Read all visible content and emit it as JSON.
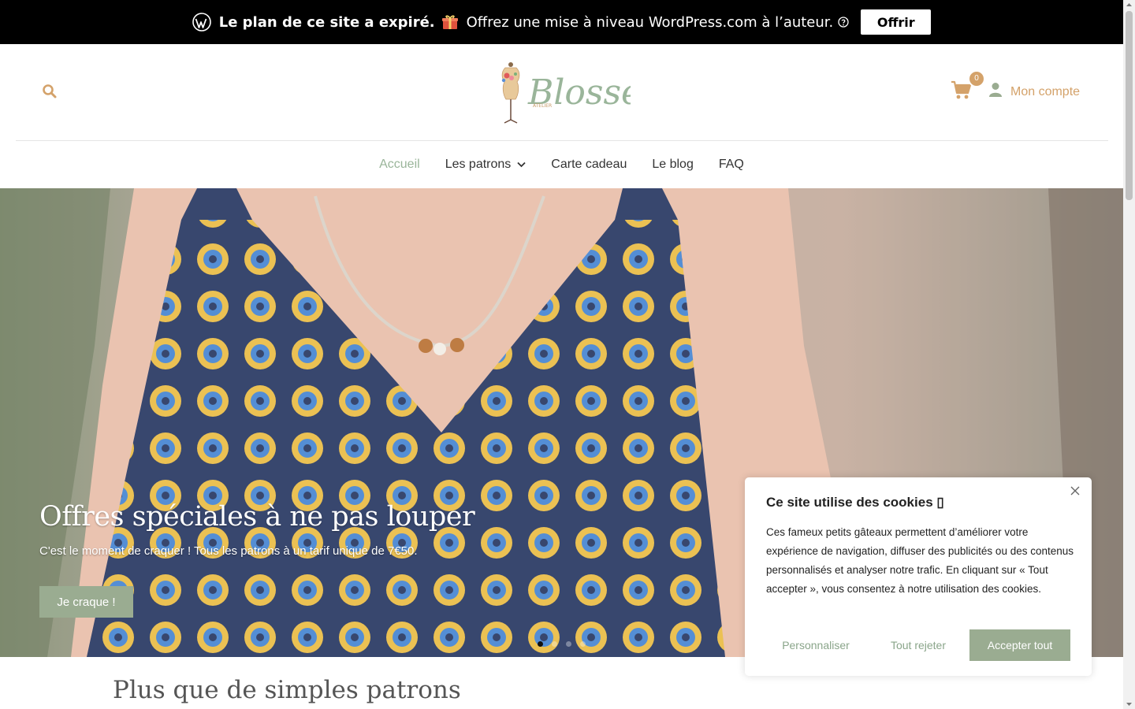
{
  "banner": {
    "message_strong": "Le plan de ce site a expiré.",
    "message": "Offrez une mise à niveau WordPress.com à l’auteur.",
    "button_label": "Offrir"
  },
  "header": {
    "logo_text": "Blossew",
    "logo_subtext": "ATELIER",
    "cart_count": "0",
    "account_label": "Mon compte"
  },
  "nav": {
    "items": [
      {
        "label": "Accueil",
        "active": true
      },
      {
        "label": "Les patrons",
        "has_dropdown": true
      },
      {
        "label": "Carte cadeau"
      },
      {
        "label": "Le blog"
      },
      {
        "label": "FAQ"
      }
    ]
  },
  "hero": {
    "title": "Offres spéciales à ne pas louper",
    "subtitle": "C'est le moment de craquer ! Tous les patrons à un tarif unique de 7€50.",
    "button_label": "Je craque !",
    "slides_count": 4,
    "active_slide": 1
  },
  "section": {
    "title": "Plus que de simples patrons"
  },
  "cookie": {
    "title": "Ce site utilise des cookies ▯",
    "text": "Ces fameux petits gâteaux permettent d’améliorer votre expérience de navigation, diffuser des publicités ou des contenus personnalisés et analyser notre trafic. En cliquant sur « Tout accepter », vous consentez à notre utilisation des cookies.",
    "customize_label": "Personnaliser",
    "reject_label": "Tout rejeter",
    "accept_label": "Accepter tout"
  },
  "colors": {
    "accent_gold": "#d4a26a",
    "accent_sage": "#9aac91",
    "nav_active": "#9ab59a",
    "banner_bg": "#000000"
  },
  "icons": {
    "search": "search-icon",
    "cart": "cart-icon",
    "account": "user-icon",
    "close": "close-icon",
    "chevron": "chevron-down-icon",
    "wordpress": "wordpress-logo-icon",
    "gift": "gift-icon",
    "help": "help-icon"
  }
}
